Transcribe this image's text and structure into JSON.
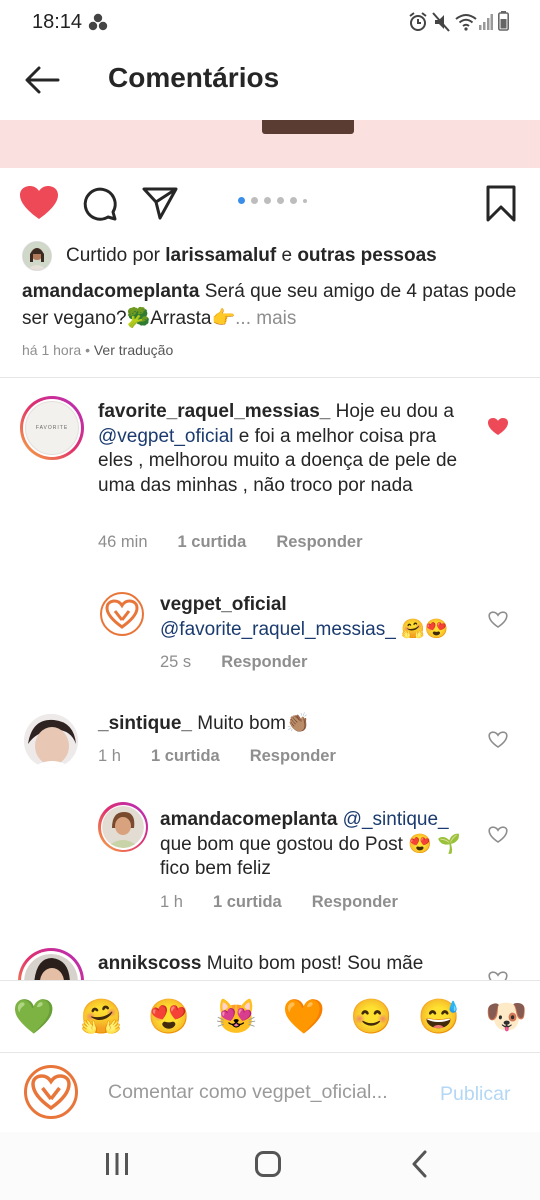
{
  "status_bar": {
    "time": "18:14"
  },
  "header": {
    "title": "Comentários"
  },
  "post": {
    "liked_prefix": "Curtido por",
    "liked_user": "larissamaluf",
    "liked_connector": "e",
    "liked_others": "outras pessoas",
    "caption_user": "amandacomeplanta",
    "caption_text": "Será que seu amigo de 4 patas pode ser vegano?🥦Arrasta👉",
    "caption_more": "... mais",
    "time": "há 1 hora",
    "separator": "•",
    "translate": "Ver tradução"
  },
  "comments": [
    {
      "user": "favorite_raquel_messias_",
      "text_before": " Hoje eu dou a ",
      "mention": "@vegpet_oficial",
      "text_after": "  e foi a melhor coisa pra eles , melhorou muito a doença de pele de uma das minhas , não troco por nada",
      "time": "46 min",
      "likes": "1 curtida",
      "reply": "Responder",
      "liked": true,
      "avatar_text": "FAVORITE"
    },
    {
      "user": "vegpet_oficial",
      "mention": " @favorite_raquel_messias_",
      "text_after": " 🤗😍",
      "time": "25 s",
      "reply": "Responder"
    },
    {
      "user": "_sintique_",
      "text": " Muito bom👏🏽",
      "time": "1 h",
      "likes": "1 curtida",
      "reply": "Responder"
    },
    {
      "user": "amandacomeplanta",
      "mention": " @_sintique_",
      "text_after": " que bom que gostou do Post 😍 🌱 fico bem feliz",
      "time": "1 h",
      "likes": "1 curtida",
      "reply": "Responder"
    },
    {
      "user": "annikscoss",
      "text": " Muito bom post! Sou mãe"
    }
  ],
  "emoji_bar": [
    "💚",
    "🤗",
    "😍",
    "😻",
    "🧡",
    "😊",
    "😅",
    "🐶"
  ],
  "composer": {
    "placeholder": "Comentar como vegpet_oficial...",
    "publish": "Publicar"
  },
  "colors": {
    "heart": "#ed4956",
    "mention": "#1b3b6f",
    "publish_disabled": "#b3d7f5",
    "brand_orange": "#e8763a",
    "carousel_active": "#3a8eea"
  },
  "icons": [
    "back-arrow-icon",
    "heart-icon",
    "comment-icon",
    "share-icon",
    "bookmark-icon",
    "recents-icon",
    "home-icon",
    "back-icon"
  ]
}
